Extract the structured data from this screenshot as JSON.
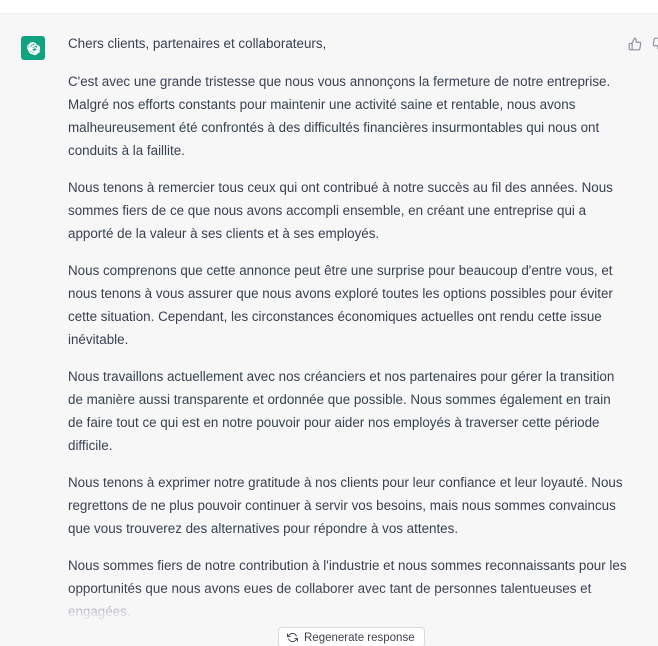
{
  "message": {
    "role_icon": "openai-logo-icon",
    "paragraphs": [
      "Chers clients, partenaires et collaborateurs,",
      "C'est avec une grande tristesse que nous vous annonçons la fermeture de notre entreprise. Malgré nos efforts constants pour maintenir une activité saine et rentable, nous avons malheureusement été confrontés à des difficultés financières insurmontables qui nous ont conduits à la faillite.",
      "Nous tenons à remercier tous ceux qui ont contribué à notre succès au fil des années. Nous sommes fiers de ce que nous avons accompli ensemble, en créant une entreprise qui a apporté de la valeur à ses clients et à ses employés.",
      "Nous comprenons que cette annonce peut être une surprise pour beaucoup d'entre vous, et nous tenons à vous assurer que nous avons exploré toutes les options possibles pour éviter cette situation. Cependant, les circonstances économiques actuelles ont rendu cette issue inévitable.",
      "Nous travaillons actuellement avec nos créanciers et nos partenaires pour gérer la transition de manière aussi transparente et ordonnée que possible. Nous sommes également en train de faire tout ce qui est en notre pouvoir pour aider nos employés à traverser cette période difficile.",
      "Nous tenons à exprimer notre gratitude à nos clients pour leur confiance et leur loyauté. Nous regrettons de ne plus pouvoir continuer à servir vos besoins, mais nous sommes convaincus que vous trouverez des alternatives pour répondre à vos attentes.",
      "Nous sommes fiers de notre contribution à l'industrie et nous sommes reconnaissants pour les opportunités que nous avons eues de collaborer avec tant de personnes talentueuses et engagées."
    ],
    "actions": {
      "thumbs_up_icon": "thumbs-up-icon",
      "thumbs_down_icon": "thumbs-down-icon"
    }
  },
  "regenerate": {
    "icon": "refresh-icon",
    "label": "Regenerate response"
  },
  "colors": {
    "accent": "#10a37f",
    "message_background": "#f7f7f8",
    "text": "#374151"
  }
}
